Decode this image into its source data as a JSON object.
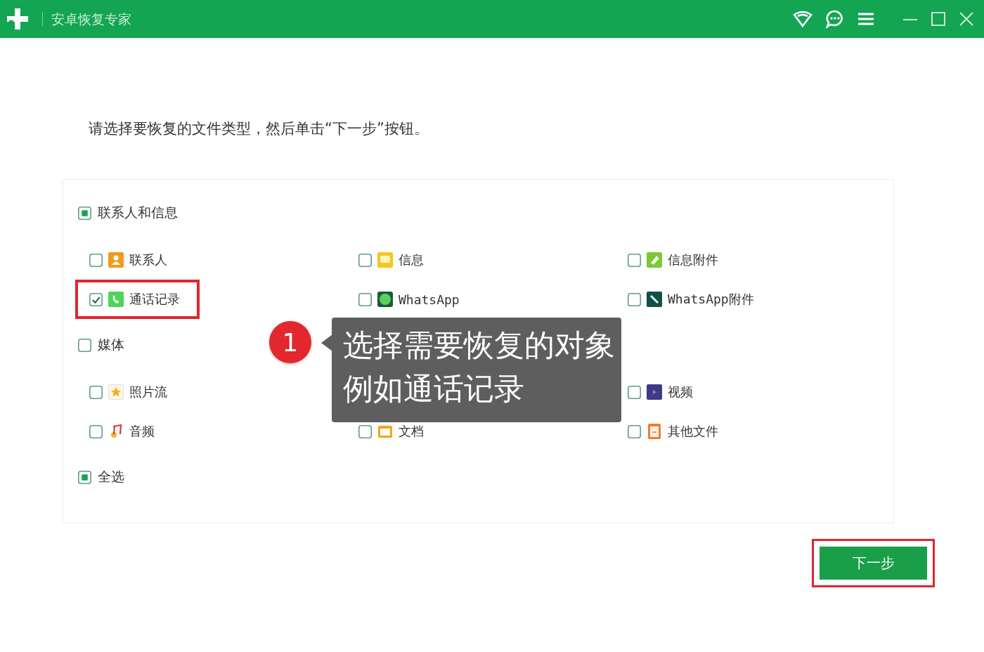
{
  "window": {
    "title": "安卓恢复专家"
  },
  "instruction": "请选择要恢复的文件类型，然后单击“下一步”按钮。",
  "groups": [
    {
      "label": "联系人和信息",
      "checked": false,
      "indeterminate": true,
      "items": [
        {
          "kind": "contacts",
          "label": "联系人",
          "checked": false,
          "highlighted": false
        },
        {
          "kind": "messages",
          "label": "信息",
          "checked": false,
          "highlighted": false
        },
        {
          "kind": "attachment",
          "label": "信息附件",
          "checked": false,
          "highlighted": false
        },
        {
          "kind": "calls",
          "label": "通话记录",
          "checked": true,
          "highlighted": true
        },
        {
          "kind": "whatsapp",
          "label": "WhatsApp",
          "checked": false,
          "highlighted": false
        },
        {
          "kind": "whatsapp-attachment",
          "label": "WhatsApp附件",
          "checked": false,
          "highlighted": false
        }
      ]
    },
    {
      "label": "媒体",
      "checked": false,
      "indeterminate": false,
      "items": [
        {
          "kind": "photostream",
          "label": "照片流",
          "checked": false,
          "highlighted": false
        },
        {
          "kind": "covered"
        },
        {
          "kind": "video",
          "label": "视频",
          "checked": false,
          "highlighted": false
        },
        {
          "kind": "audio",
          "label": "音频",
          "checked": false,
          "highlighted": false
        },
        {
          "kind": "documents",
          "label": "文档",
          "checked": false,
          "highlighted": false
        },
        {
          "kind": "other-files",
          "label": "其他文件",
          "checked": false,
          "highlighted": false
        }
      ]
    }
  ],
  "select_all": {
    "label": "全选",
    "checked": false,
    "indeterminate": true
  },
  "next_button": {
    "label": "下一步",
    "highlighted": true
  },
  "callout": {
    "number": "1",
    "lines": [
      "选择需要恢复的对象",
      "例如通话记录"
    ]
  }
}
